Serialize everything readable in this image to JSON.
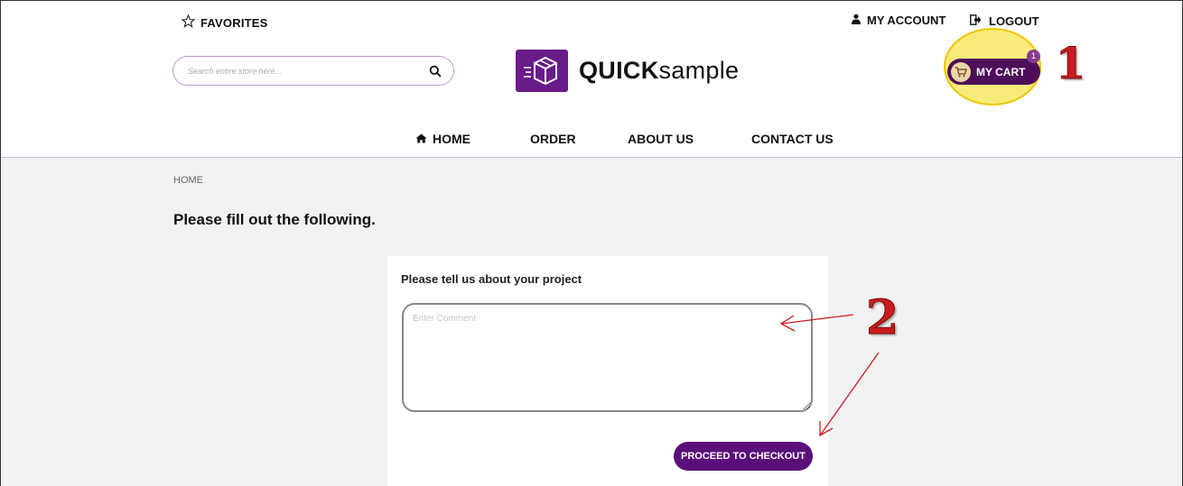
{
  "header": {
    "favorites_label": "FAVORITES",
    "account_label": "MY ACCOUNT",
    "logout_label": "LOGOUT",
    "search_placeholder": "Search entire store here...",
    "logo_bold": "QUICK",
    "logo_light": "sample",
    "cart_label": "MY CART",
    "cart_count": "1"
  },
  "nav": {
    "home": "HOME",
    "order": "ORDER",
    "about": "ABOUT US",
    "contact": "CONTACT US"
  },
  "breadcrumb": "HOME",
  "page_heading": "Please fill out the following.",
  "form": {
    "label": "Please tell us about your project",
    "comment_placeholder": "Enter Comment",
    "checkout_label": "PROCEED TO CHECKOUT"
  },
  "annotations": {
    "callout_1": "1",
    "callout_2": "2"
  },
  "colors": {
    "brand_purple": "#5a0f7a",
    "cart_dark": "#4d0f5a",
    "highlight_yellow": "#f7ec7a",
    "annotation_red": "#c91c1c"
  },
  "icons": [
    "star-icon",
    "user-icon",
    "logout-icon",
    "search-icon",
    "box-logo-icon",
    "cart-icon",
    "home-icon"
  ]
}
